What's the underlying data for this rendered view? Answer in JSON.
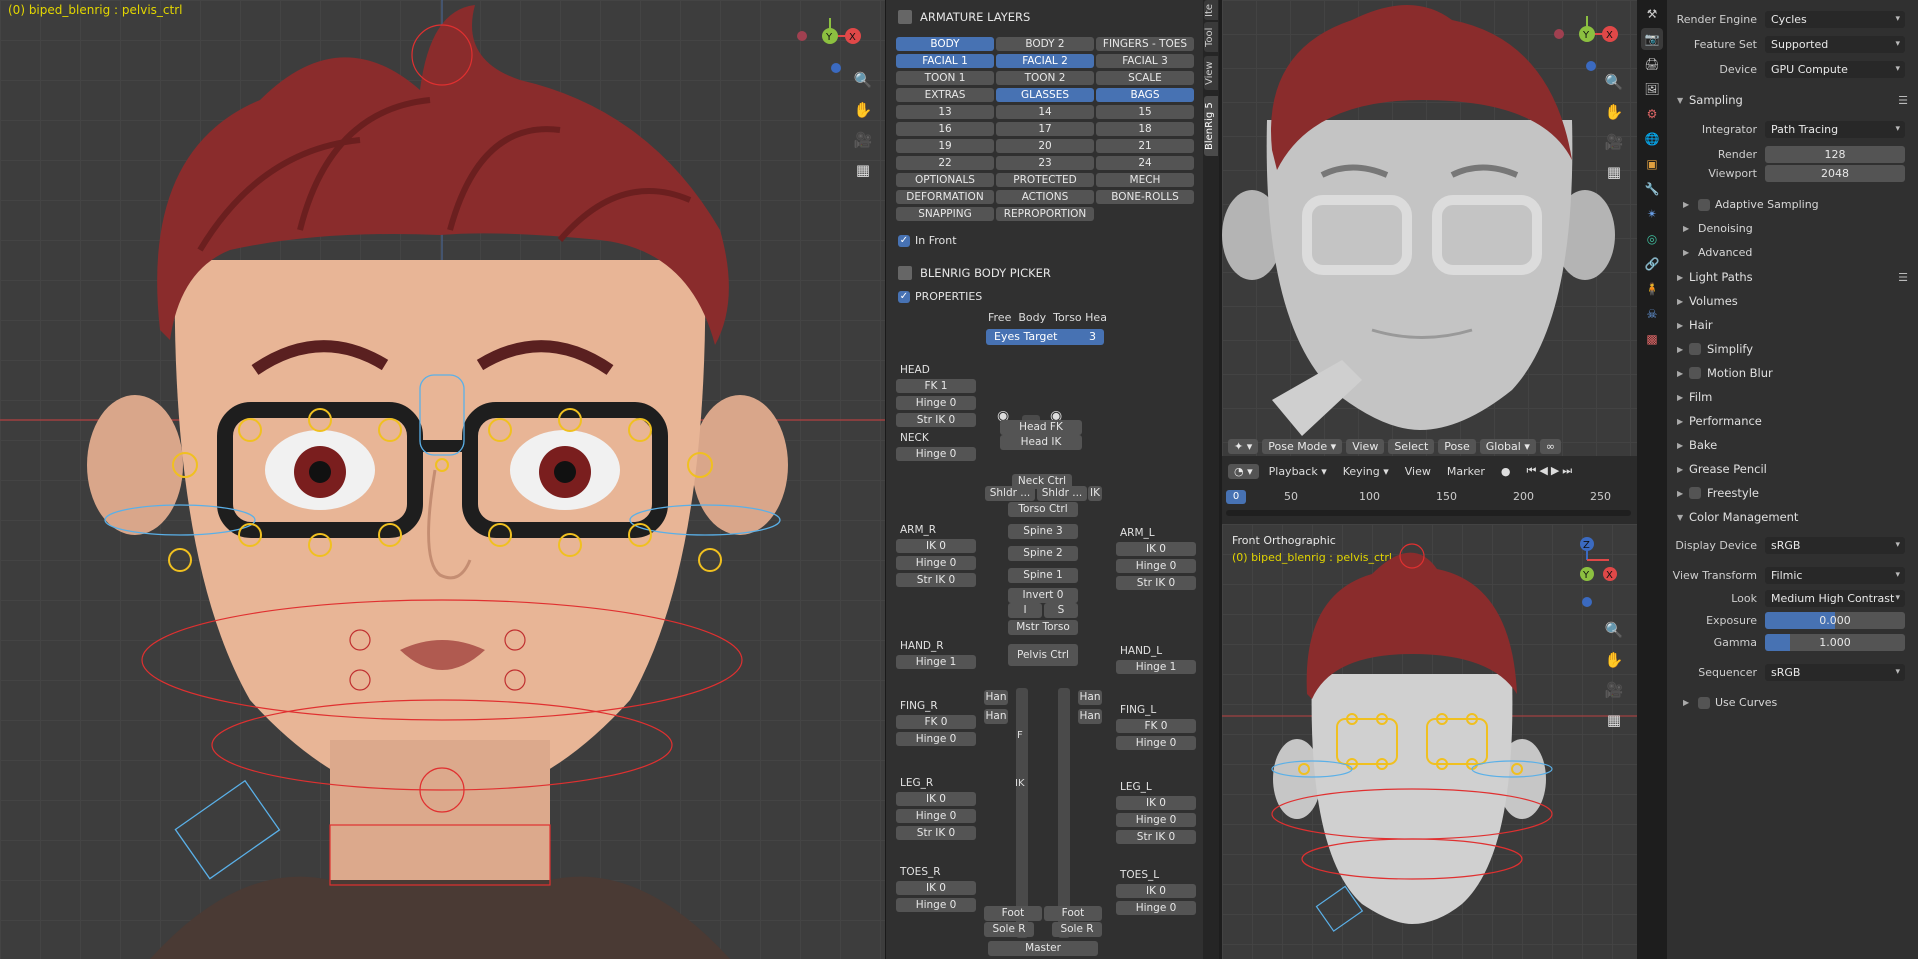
{
  "viewport_main": {
    "object_label": "(0) biped_blenrig : pelvis_ctrl"
  },
  "picker": {
    "armature_layers_title": "ARMATURE LAYERS",
    "layers": [
      {
        "label": "BODY",
        "on": true
      },
      {
        "label": "BODY 2",
        "on": false
      },
      {
        "label": "FINGERS - TOES",
        "on": false
      },
      {
        "label": "FACIAL 1",
        "on": true
      },
      {
        "label": "FACIAL 2",
        "on": true
      },
      {
        "label": "FACIAL 3",
        "on": false
      },
      {
        "label": "TOON 1",
        "on": false
      },
      {
        "label": "TOON 2",
        "on": false
      },
      {
        "label": "SCALE",
        "on": false
      },
      {
        "label": "EXTRAS",
        "on": false
      },
      {
        "label": "GLASSES",
        "on": true
      },
      {
        "label": "BAGS",
        "on": true
      },
      {
        "label": "13",
        "on": false
      },
      {
        "label": "14",
        "on": false
      },
      {
        "label": "15",
        "on": false
      },
      {
        "label": "16",
        "on": false
      },
      {
        "label": "17",
        "on": false
      },
      {
        "label": "18",
        "on": false
      },
      {
        "label": "19",
        "on": false
      },
      {
        "label": "20",
        "on": false
      },
      {
        "label": "21",
        "on": false
      },
      {
        "label": "22",
        "on": false
      },
      {
        "label": "23",
        "on": false
      },
      {
        "label": "24",
        "on": false
      },
      {
        "label": "OPTIONALS",
        "on": false
      },
      {
        "label": "PROTECTED",
        "on": false
      },
      {
        "label": "MECH",
        "on": false
      },
      {
        "label": "DEFORMATION",
        "on": false
      },
      {
        "label": "ACTIONS",
        "on": false
      },
      {
        "label": "BONE-ROLLS",
        "on": false
      },
      {
        "label": "SNAPPING",
        "on": false
      },
      {
        "label": "REPROPORTION",
        "on": false
      }
    ],
    "in_front": "In Front",
    "body_picker_title": "BLENRIG BODY PICKER",
    "properties": "PROPERTIES",
    "eyes_modes": "Free  Body  Torso Hea",
    "eyes_target_label": "Eyes Target",
    "eyes_target_value": "3",
    "left_groups": [
      {
        "title": "HEAD",
        "rows": [
          "FK 1",
          "Hinge 0",
          "Str IK 0"
        ]
      },
      {
        "title": "NECK",
        "rows": [
          "Hinge 0"
        ]
      },
      {
        "title": "ARM_R",
        "rows": [
          "IK 0",
          "Hinge 0",
          "Str IK 0"
        ]
      },
      {
        "title": "HAND_R",
        "rows": [
          "Hinge 1"
        ]
      },
      {
        "title": "FING_R",
        "rows": [
          "FK 0",
          "Hinge 0"
        ]
      },
      {
        "title": "LEG_R",
        "rows": [
          "IK 0",
          "Hinge 0",
          "Str IK 0"
        ]
      },
      {
        "title": "TOES_R",
        "rows": [
          "IK 0",
          "Hinge 0"
        ]
      }
    ],
    "right_groups": [
      {
        "title": "ARM_L",
        "rows": [
          "IK 0",
          "Hinge 0",
          "Str IK 0"
        ]
      },
      {
        "title": "HAND_L",
        "rows": [
          "Hinge 1"
        ]
      },
      {
        "title": "FING_L",
        "rows": [
          "FK 0",
          "Hinge 0"
        ]
      },
      {
        "title": "LEG_L",
        "rows": [
          "IK 0",
          "Hinge 0",
          "Str IK 0"
        ]
      },
      {
        "title": "TOES_L",
        "rows": [
          "IK 0",
          "Hinge 0"
        ]
      }
    ],
    "bones": {
      "head_fk": "Head FK",
      "head_ik": "Head IK",
      "neck_ctrl": "Neck Ctrl",
      "shldr_r": "Shldr ...",
      "shldr_l": "Shldr ...",
      "ik_l": "IK",
      "torso_ctrl": "Torso Ctrl",
      "spine3": "Spine 3",
      "spine2": "Spine 2",
      "spine1": "Spine 1",
      "invert": "Invert 0",
      "i": "I",
      "s": "S",
      "mstr_torso": "Mstr Torso",
      "pelvis_ctrl": "Pelvis Ctrl",
      "han1": "Han",
      "han2": "Han",
      "han3": "Han",
      "han4": "Han",
      "f": "F",
      "ik": "IK",
      "foot_r": "Foot",
      "foot_l": "Foot",
      "sole_r": "Sole R",
      "sole_l": "Sole R",
      "master": "Master"
    }
  },
  "side_tabs": [
    "Ite",
    "Tool",
    "View",
    "BlenRig 5"
  ],
  "viewport_top": {
    "mode": "Pose Mode",
    "view": "View",
    "select": "Select",
    "pose": "Pose",
    "orientation": "Global"
  },
  "timeline": {
    "playback": "Playback",
    "keying": "Keying",
    "view": "View",
    "marker": "Marker",
    "current_frame": "0",
    "ticks": [
      "50",
      "100",
      "150",
      "200",
      "250"
    ]
  },
  "viewport_bottom": {
    "view_name": "Front Orthographic",
    "object_label": "(0) biped_blenrig : pelvis_ctrl"
  },
  "properties": {
    "render_engine_label": "Render Engine",
    "render_engine": "Cycles",
    "feature_set_label": "Feature Set",
    "feature_set": "Supported",
    "device_label": "Device",
    "device": "GPU Compute",
    "sampling": "Sampling",
    "integrator_label": "Integrator",
    "integrator": "Path Tracing",
    "render_label": "Render",
    "render_samples": "128",
    "viewport_label": "Viewport",
    "viewport_samples": "2048",
    "adaptive_sampling": "Adaptive Sampling",
    "denoising": "Denoising",
    "advanced": "Advanced",
    "light_paths": "Light Paths",
    "volumes": "Volumes",
    "hair": "Hair",
    "simplify": "Simplify",
    "motion_blur": "Motion Blur",
    "film": "Film",
    "performance": "Performance",
    "bake": "Bake",
    "grease_pencil": "Grease Pencil",
    "freestyle": "Freestyle",
    "color_management": "Color Management",
    "display_device_label": "Display Device",
    "display_device": "sRGB",
    "view_transform_label": "View Transform",
    "view_transform": "Filmic",
    "look_label": "Look",
    "look": "Medium High Contrast",
    "exposure_label": "Exposure",
    "exposure": "0.000",
    "gamma_label": "Gamma",
    "gamma": "1.000",
    "sequencer_label": "Sequencer",
    "sequencer": "sRGB",
    "use_curves": "Use Curves"
  },
  "colors": {
    "accent": "#4772b3",
    "panel": "#303030",
    "viewport": "#3d3d3d",
    "selected_bone": "#f0c020",
    "label_yellow": "#e3d600"
  }
}
